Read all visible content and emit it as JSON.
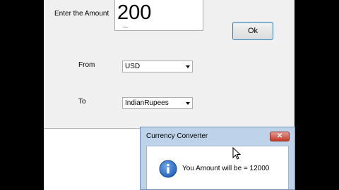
{
  "form": {
    "amount_label": "Enter the Amount",
    "amount_value": "200",
    "ok_label": "Ok",
    "from_label": "From",
    "from_value": "USD",
    "to_label": "To",
    "to_value": "IndianRupees"
  },
  "dialog": {
    "title": "Currency Converter",
    "close_label": "✕",
    "message": "You Amount will be = 12000",
    "icon": "info-icon"
  },
  "colors": {
    "form_bg": "#f0f0f0",
    "dialog_frame": "#bed3ea",
    "close_red": "#c43a2a",
    "info_blue": "#1f5fb8"
  }
}
